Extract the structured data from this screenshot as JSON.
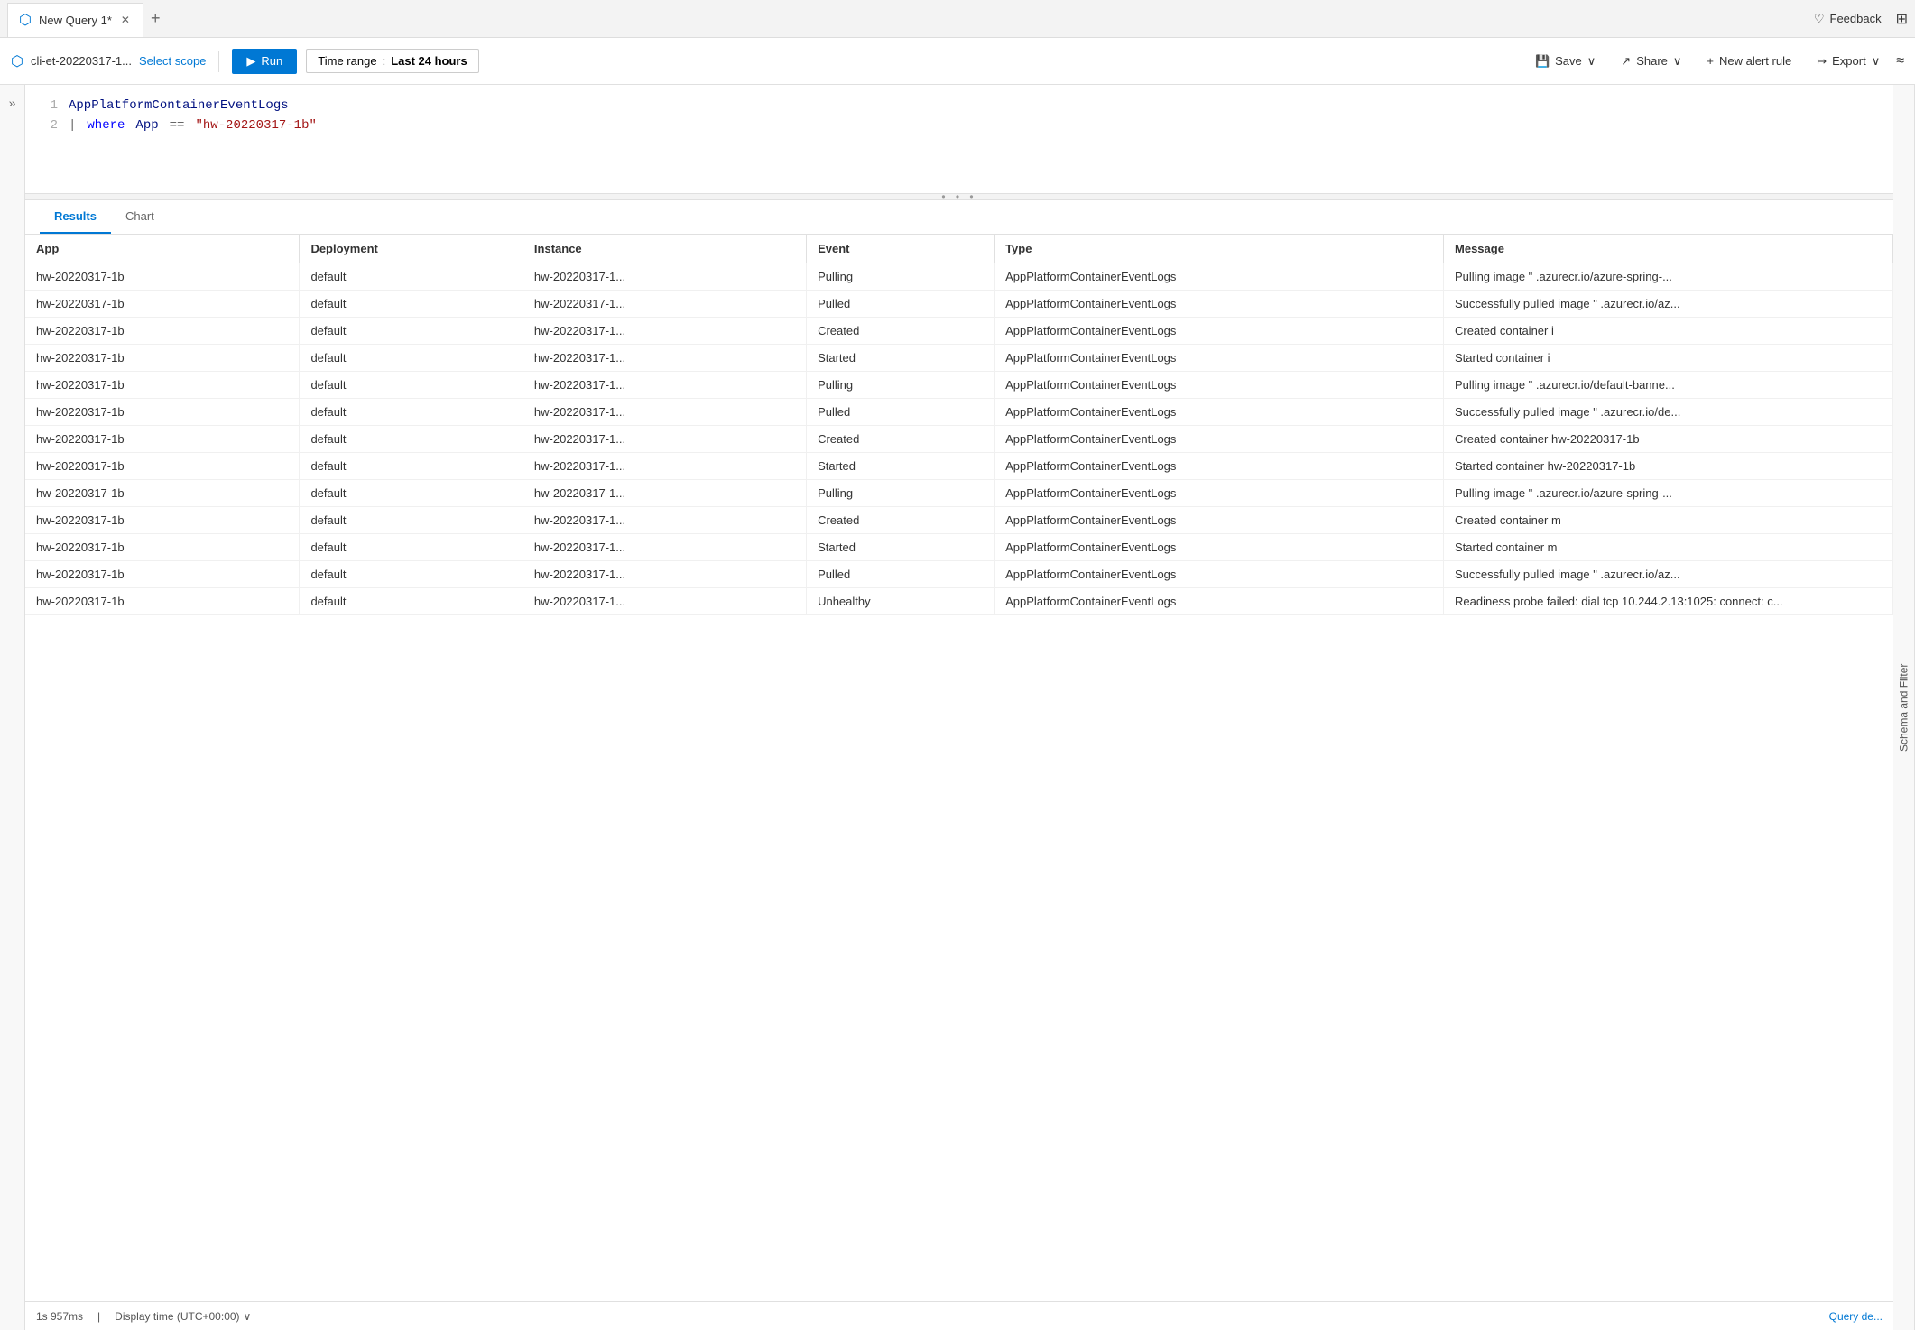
{
  "tab": {
    "title": "New Query 1*",
    "azure_icon": "⬡",
    "close_icon": "✕",
    "add_icon": "+"
  },
  "top_right": {
    "feedback_label": "Feedback",
    "grid_icon": "⊞"
  },
  "toolbar": {
    "azure_icon": "⬡",
    "scope_name": "cli-et-20220317-1...",
    "select_scope_label": "Select scope",
    "run_label": "Run",
    "time_range_label": "Time range",
    "time_range_value": "Last 24 hours",
    "save_label": "Save",
    "share_label": "Share",
    "new_alert_label": "New alert rule",
    "export_label": "Export"
  },
  "editor": {
    "line1_num": "1",
    "line1_code": "AppPlatformContainerEventLogs",
    "line2_num": "2",
    "line2_pipe": "|",
    "line2_keyword": "where",
    "line2_field": "App",
    "line2_operator": "==",
    "line2_string": "\"hw-20220317-1b\""
  },
  "results": {
    "tab_results": "Results",
    "tab_chart": "Chart",
    "columns": [
      "App",
      "Deployment",
      "Instance",
      "Event",
      "Type",
      "Message"
    ],
    "rows": [
      [
        "hw-20220317-1b",
        "default",
        "hw-20220317-1...",
        "Pulling",
        "AppPlatformContainerEventLogs",
        "Pulling image \"         .azurecr.io/azure-spring-..."
      ],
      [
        "hw-20220317-1b",
        "default",
        "hw-20220317-1...",
        "Pulled",
        "AppPlatformContainerEventLogs",
        "Successfully pulled image \"         .azurecr.io/az..."
      ],
      [
        "hw-20220317-1b",
        "default",
        "hw-20220317-1...",
        "Created",
        "AppPlatformContainerEventLogs",
        "Created container i"
      ],
      [
        "hw-20220317-1b",
        "default",
        "hw-20220317-1...",
        "Started",
        "AppPlatformContainerEventLogs",
        "Started container i"
      ],
      [
        "hw-20220317-1b",
        "default",
        "hw-20220317-1...",
        "Pulling",
        "AppPlatformContainerEventLogs",
        "Pulling image \"         .azurecr.io/default-banne..."
      ],
      [
        "hw-20220317-1b",
        "default",
        "hw-20220317-1...",
        "Pulled",
        "AppPlatformContainerEventLogs",
        "Successfully pulled image \"         .azurecr.io/de..."
      ],
      [
        "hw-20220317-1b",
        "default",
        "hw-20220317-1...",
        "Created",
        "AppPlatformContainerEventLogs",
        "Created container hw-20220317-1b"
      ],
      [
        "hw-20220317-1b",
        "default",
        "hw-20220317-1...",
        "Started",
        "AppPlatformContainerEventLogs",
        "Started container hw-20220317-1b"
      ],
      [
        "hw-20220317-1b",
        "default",
        "hw-20220317-1...",
        "Pulling",
        "AppPlatformContainerEventLogs",
        "Pulling image \"         .azurecr.io/azure-spring-..."
      ],
      [
        "hw-20220317-1b",
        "default",
        "hw-20220317-1...",
        "Created",
        "AppPlatformContainerEventLogs",
        "Created container m"
      ],
      [
        "hw-20220317-1b",
        "default",
        "hw-20220317-1...",
        "Started",
        "AppPlatformContainerEventLogs",
        "Started container m"
      ],
      [
        "hw-20220317-1b",
        "default",
        "hw-20220317-1...",
        "Pulled",
        "AppPlatformContainerEventLogs",
        "Successfully pulled image \"         .azurecr.io/az..."
      ],
      [
        "hw-20220317-1b",
        "default",
        "hw-20220317-1...",
        "Unhealthy",
        "AppPlatformContainerEventLogs",
        "Readiness probe failed: dial tcp 10.244.2.13:1025: connect: c..."
      ]
    ]
  },
  "status_bar": {
    "duration": "1s 957ms",
    "display_time": "Display time (UTC+00:00)",
    "chevron": "∨",
    "query_detail": "Query de..."
  },
  "schema_filter_label": "Schema and Filter"
}
